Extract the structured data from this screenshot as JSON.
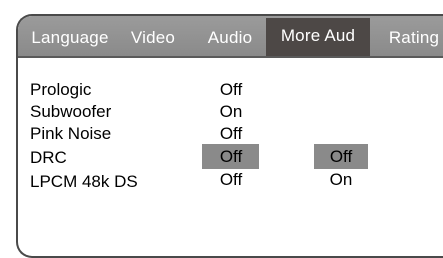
{
  "tabs": [
    {
      "label": "Language"
    },
    {
      "label": "Video"
    },
    {
      "label": "Audio"
    },
    {
      "label": "More Aud",
      "active": true
    },
    {
      "label": "Rating"
    }
  ],
  "settings": [
    {
      "label": "Prologic",
      "value": "Off"
    },
    {
      "label": "Subwoofer",
      "value": "On"
    },
    {
      "label": "Pink Noise",
      "value": "Off"
    },
    {
      "label": "DRC",
      "value": "Off",
      "selected": true
    },
    {
      "label": "LPCM 48k DS",
      "value": "Off"
    }
  ],
  "options": [
    {
      "label": "Off",
      "selected": true
    },
    {
      "label": "On"
    }
  ],
  "colors": {
    "tabbar": "#8f8f8f",
    "active_tab": "#4d4846",
    "highlight": "#8a8a8a"
  }
}
